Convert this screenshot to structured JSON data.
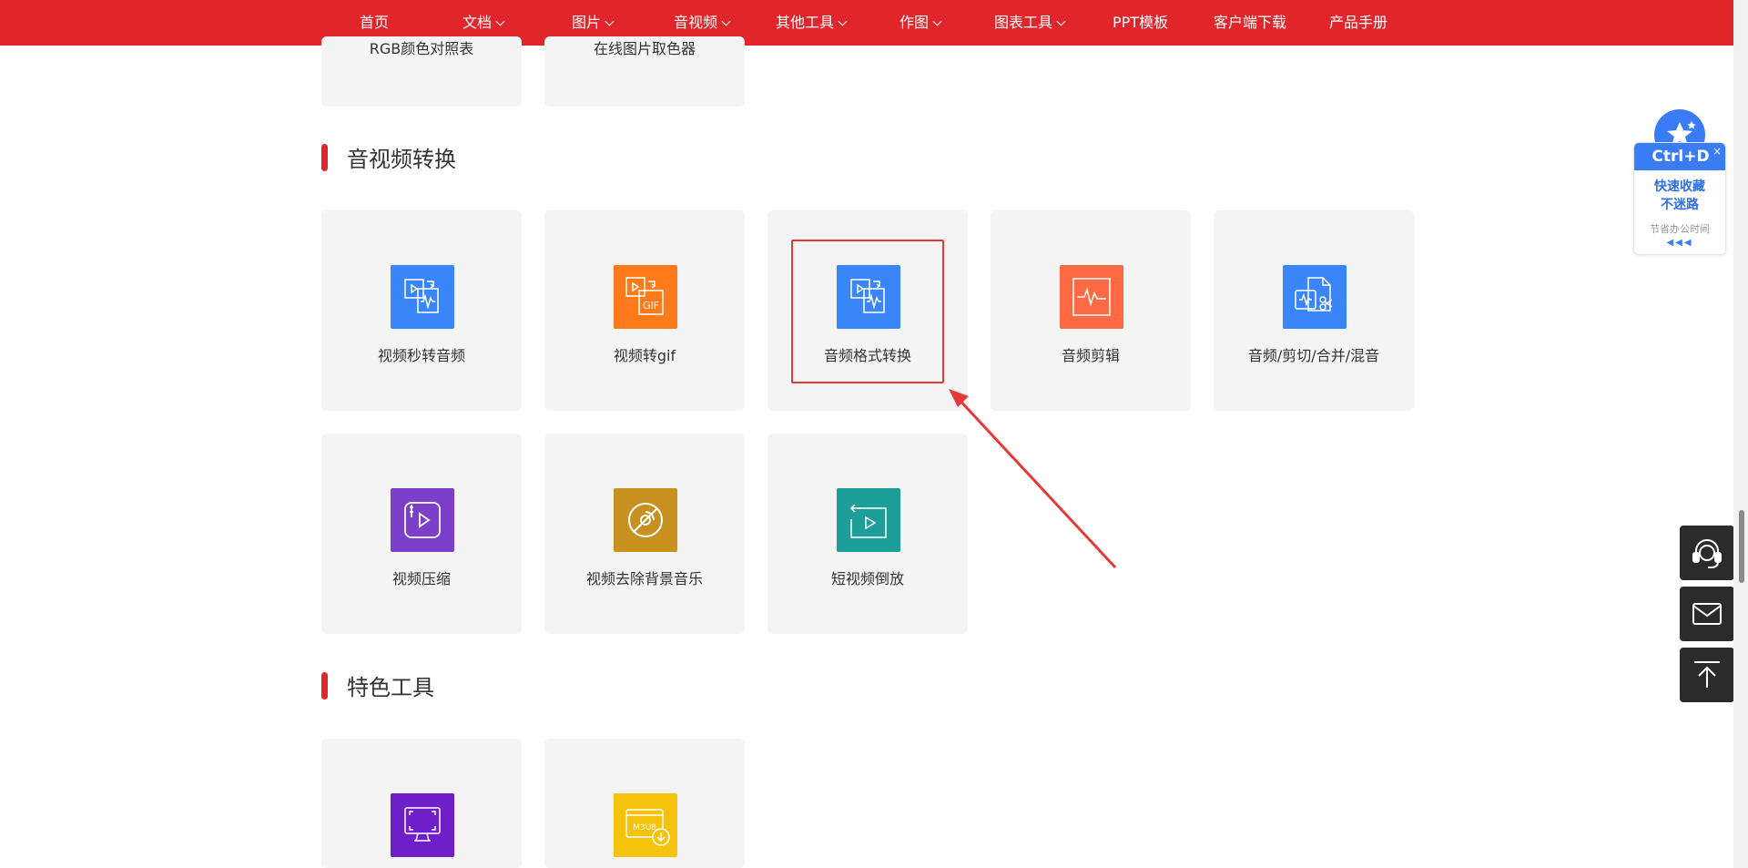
{
  "nav": {
    "items": [
      {
        "label": "首页",
        "dropdown": false
      },
      {
        "label": "文档",
        "dropdown": true
      },
      {
        "label": "图片",
        "dropdown": true
      },
      {
        "label": "音视频",
        "dropdown": true
      },
      {
        "label": "其他工具",
        "dropdown": true
      },
      {
        "label": "作图",
        "dropdown": true
      },
      {
        "label": "图表工具",
        "dropdown": true
      },
      {
        "label": "PPT模板",
        "dropdown": false
      },
      {
        "label": "客户端下载",
        "dropdown": false
      },
      {
        "label": "产品手册",
        "dropdown": false
      }
    ]
  },
  "top_partial_cards": [
    {
      "label": "RGB颜色对照表"
    },
    {
      "label": "在线图片取色器"
    }
  ],
  "sections": [
    {
      "title": "音视频转换",
      "tools": [
        {
          "label": "视频秒转音频",
          "icon": "video-to-audio-icon",
          "color": "#3a86f8"
        },
        {
          "label": "视频转gif",
          "icon": "video-to-gif-icon",
          "color": "#ff7a1a"
        },
        {
          "label": "音频格式转换",
          "icon": "audio-format-convert-icon",
          "color": "#3a86f8"
        },
        {
          "label": "音频剪辑",
          "icon": "audio-clip-icon",
          "color": "#ff6a45"
        },
        {
          "label": "音频/剪切/合并/混音",
          "icon": "audio-cut-merge-icon",
          "color": "#3a86f8"
        },
        {
          "label": "视频压缩",
          "icon": "video-compress-icon",
          "color": "#7b3fc9"
        },
        {
          "label": "视频去除背景音乐",
          "icon": "remove-bg-music-icon",
          "color": "#c8901f"
        },
        {
          "label": "短视频倒放",
          "icon": "video-reverse-icon",
          "color": "#1e9e98"
        }
      ]
    },
    {
      "title": "特色工具",
      "tools": [
        {
          "label": "",
          "icon": "screen-record-icon",
          "color": "#6e1fc7"
        },
        {
          "label": "",
          "icon": "m3u8-download-icon",
          "color": "#f5c30e"
        }
      ]
    }
  ],
  "favorite_widget": {
    "shortcut": "Ctrl+D",
    "line1": "快速收藏",
    "line2": "不迷路",
    "line3": "节省办公时间",
    "close": "×"
  },
  "side_buttons": [
    {
      "name": "customer-service",
      "icon": "headset-icon"
    },
    {
      "name": "email",
      "icon": "mail-icon"
    },
    {
      "name": "back-to-top",
      "icon": "arrow-up-icon"
    }
  ],
  "m3u8_icon_text": "M3U8",
  "gif_icon_text": "GIF",
  "colors": {
    "brand_red": "#e0262b",
    "card_bg": "#f4f4f4",
    "highlight": "#e53935"
  }
}
